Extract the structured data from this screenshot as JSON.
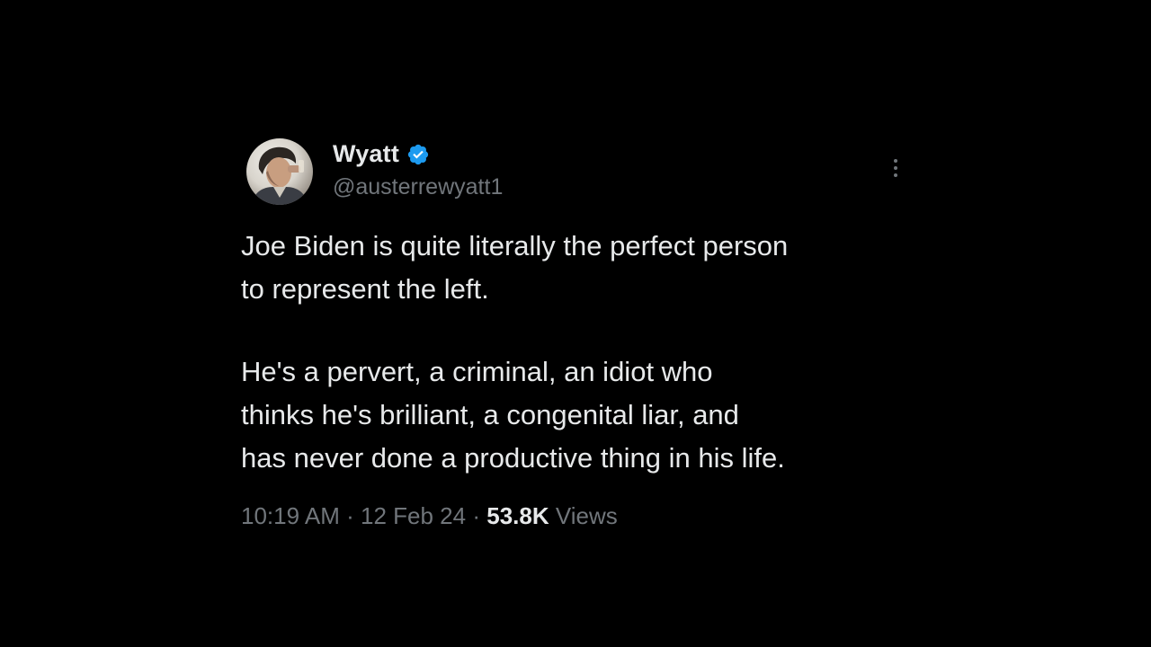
{
  "tweet": {
    "author": {
      "display_name": "Wyatt",
      "handle": "@austerrewyatt1",
      "verified": true,
      "avatar_icon": "profile-photo"
    },
    "text_paragraphs": [
      [
        "Joe Biden is quite literally the perfect person",
        "to represent the left."
      ],
      [
        "He's a pervert, a criminal, an idiot who",
        "thinks he's brilliant, a congenital liar, and",
        "has never done a productive thing in his life."
      ]
    ],
    "meta": {
      "time": "10:19 AM",
      "date": "12 Feb 24",
      "separator": "·",
      "views_count": "53.8K",
      "views_label": "Views"
    },
    "icons": {
      "verified": "verified-badge-icon",
      "more": "more-options-icon"
    }
  },
  "colors": {
    "background": "#000000",
    "primary_text": "#e7e9ea",
    "secondary_text": "#71767b",
    "verified_blue": "#1d9bf0"
  }
}
